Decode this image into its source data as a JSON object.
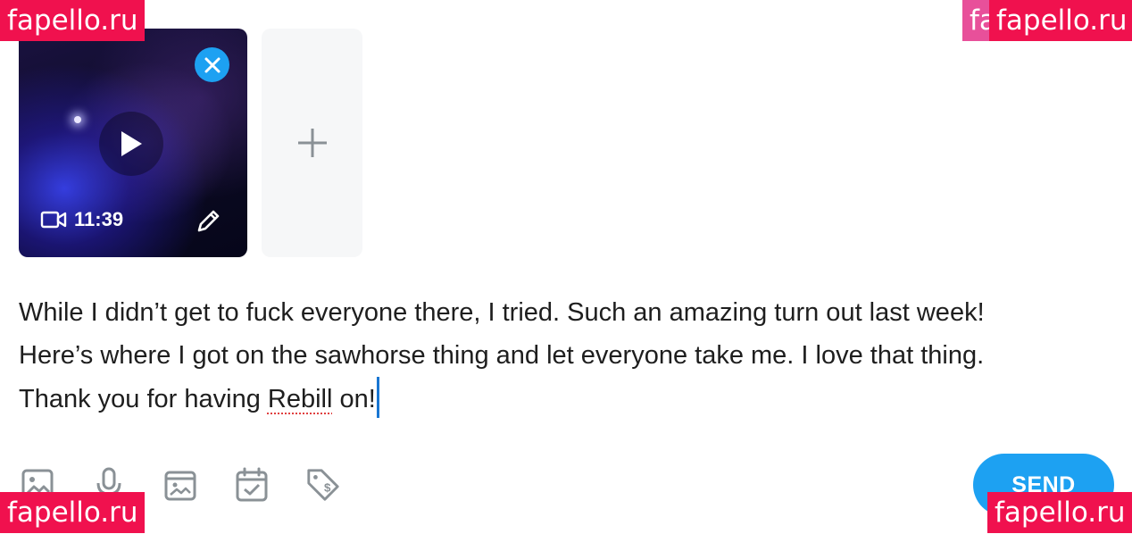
{
  "media": {
    "video": {
      "duration": "11:39"
    }
  },
  "post": {
    "lines": [
      "While I didn’t get to fuck everyone there, I tried. Such an amazing turn out last week!",
      "Here’s where I got on the sawhorse thing and let everyone take me. I love that thing.",
      "Thank you for having "
    ],
    "misspelled_word": "Rebill",
    "line3_end": " on!"
  },
  "toolbar": {
    "icons": [
      "image-icon",
      "microphone-icon",
      "vault-icon",
      "schedule-icon",
      "price-tag-icon"
    ]
  },
  "send_label": "SEND",
  "watermarks": {
    "top_left": "fapello.ru",
    "top_right_under": "fa",
    "top_right": "fapello.ru",
    "bottom_left": "fapello.ru",
    "bottom_right": "fapello.ru"
  },
  "colors": {
    "accent": "#1da1f2",
    "watermark": "#f0114e",
    "caret": "#1976d2"
  }
}
